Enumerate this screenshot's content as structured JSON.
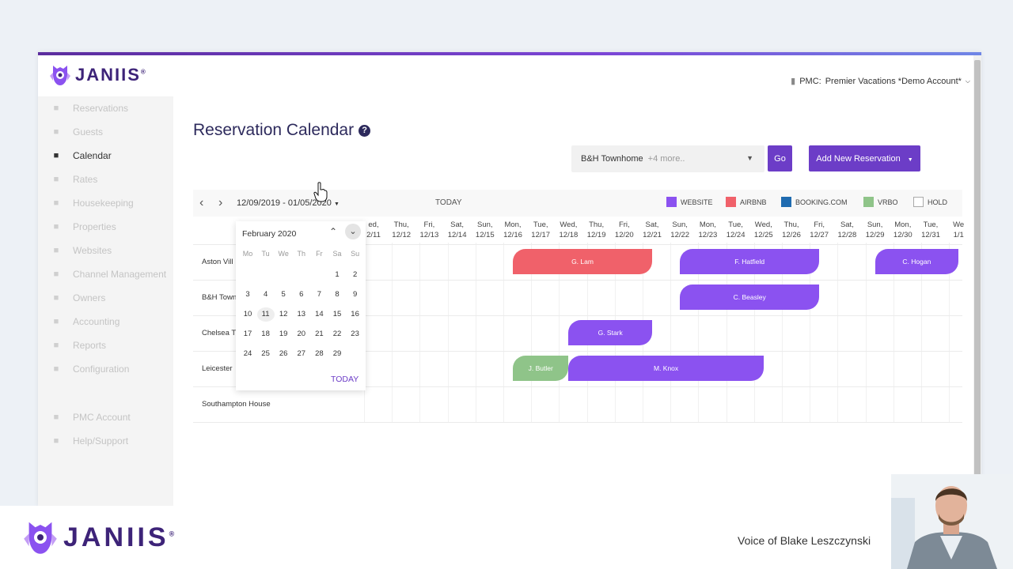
{
  "app": {
    "logo": "JANIIS",
    "trademark": "®",
    "pmc_label": "PMC:",
    "pmc_value": "Premier Vacations *Demo Account*"
  },
  "sidebar": {
    "items": [
      {
        "label": "Reservations",
        "icon": "id-card-icon",
        "active": false
      },
      {
        "label": "Guests",
        "icon": "guest-card-icon",
        "active": false
      },
      {
        "label": "Calendar",
        "icon": "calendar-icon",
        "active": true
      },
      {
        "label": "Rates",
        "icon": "dollar-icon",
        "active": false
      },
      {
        "label": "Housekeeping",
        "icon": "broom-icon",
        "active": false
      },
      {
        "label": "Properties",
        "icon": "home-icon",
        "active": false
      },
      {
        "label": "Websites",
        "icon": "monitor-icon",
        "active": false
      },
      {
        "label": "Channel Management",
        "icon": "chart-line-icon",
        "active": false
      },
      {
        "label": "Owners",
        "icon": "eye-icon",
        "active": false
      },
      {
        "label": "Accounting",
        "icon": "calculator-icon",
        "active": false
      },
      {
        "label": "Reports",
        "icon": "bar-chart-icon",
        "active": false
      },
      {
        "label": "Configuration",
        "icon": "gear-icon",
        "active": false
      }
    ],
    "bottom": [
      {
        "label": "PMC Account",
        "icon": "building-icon"
      },
      {
        "label": "Help/Support",
        "icon": "question-icon"
      }
    ]
  },
  "main": {
    "title": "Reservation Calendar",
    "help": "?",
    "property_select": "B&H Townhome",
    "property_more": "+4 more..",
    "go_label": "Go",
    "add_label": "Add New Reservation"
  },
  "calendar": {
    "date_range": "12/09/2019 - 01/05/2020",
    "today_label": "TODAY",
    "legend": [
      {
        "label": "WEBSITE",
        "color": "#8b52f0",
        "filled": true
      },
      {
        "label": "AIRBNB",
        "color": "#f0616a",
        "filled": true
      },
      {
        "label": "BOOKING.COM",
        "color": "#1f6bb0",
        "filled": true
      },
      {
        "label": "VRBO",
        "color": "#8fc489",
        "filled": true
      },
      {
        "label": "HOLD",
        "color": "#ffffff",
        "filled": false
      }
    ],
    "days": [
      {
        "d": "ed,",
        "n": "2/11"
      },
      {
        "d": "Thu,",
        "n": "12/12"
      },
      {
        "d": "Fri,",
        "n": "12/13"
      },
      {
        "d": "Sat,",
        "n": "12/14"
      },
      {
        "d": "Sun,",
        "n": "12/15"
      },
      {
        "d": "Mon,",
        "n": "12/16"
      },
      {
        "d": "Tue,",
        "n": "12/17"
      },
      {
        "d": "Wed,",
        "n": "12/18"
      },
      {
        "d": "Thu,",
        "n": "12/19"
      },
      {
        "d": "Fri,",
        "n": "12/20"
      },
      {
        "d": "Sat,",
        "n": "12/21"
      },
      {
        "d": "Sun,",
        "n": "12/22"
      },
      {
        "d": "Mon,",
        "n": "12/23"
      },
      {
        "d": "Tue,",
        "n": "12/24"
      },
      {
        "d": "Wed,",
        "n": "12/25"
      },
      {
        "d": "Thu,",
        "n": "12/26"
      },
      {
        "d": "Fri,",
        "n": "12/27"
      },
      {
        "d": "Sat,",
        "n": "12/28"
      },
      {
        "d": "Sun,",
        "n": "12/29"
      },
      {
        "d": "Mon,",
        "n": "12/30"
      },
      {
        "d": "Tue,",
        "n": "12/31"
      },
      {
        "d": "We",
        "n": "1/1"
      }
    ],
    "rows": [
      "Aston Vill",
      "B&H Town",
      "Chelsea T",
      "Leicester",
      "Southampton House"
    ],
    "reservations": [
      {
        "guest": "G. Lam",
        "row": 0,
        "start": "12/16",
        "end": "12/21",
        "color": "#f0616a"
      },
      {
        "guest": "F. Hatfield",
        "row": 0,
        "start": "12/22",
        "end": "12/27",
        "color": "#8b52f0"
      },
      {
        "guest": "C. Hogan",
        "row": 0,
        "start": "12/29",
        "end": "1/1",
        "color": "#8b52f0"
      },
      {
        "guest": "C. Beasley",
        "row": 1,
        "start": "12/22",
        "end": "12/27",
        "color": "#8b52f0"
      },
      {
        "guest": "G. Stark",
        "row": 2,
        "start": "12/18",
        "end": "12/21",
        "color": "#8b52f0"
      },
      {
        "guest": "J. Butler",
        "row": 3,
        "start": "12/16",
        "end": "12/18",
        "color": "#8fc489"
      },
      {
        "guest": "M. Knox",
        "row": 3,
        "start": "12/18",
        "end": "12/25",
        "color": "#8b52f0"
      }
    ]
  },
  "datepicker": {
    "month": "February 2020",
    "weekdays": [
      "Mo",
      "Tu",
      "We",
      "Th",
      "Fr",
      "Sa",
      "Su"
    ],
    "weeks": [
      [
        "",
        "",
        "",
        "",
        "",
        "1",
        "2"
      ],
      [
        "3",
        "4",
        "5",
        "6",
        "7",
        "8",
        "9"
      ],
      [
        "10",
        "11",
        "12",
        "13",
        "14",
        "15",
        "16"
      ],
      [
        "17",
        "18",
        "19",
        "20",
        "21",
        "22",
        "23"
      ],
      [
        "24",
        "25",
        "26",
        "27",
        "28",
        "29",
        ""
      ]
    ],
    "selected": "11",
    "today_label": "TODAY"
  },
  "footer": {
    "logo": "JANIIS",
    "trademark": "®",
    "voice": "Voice of Blake Leszczynski"
  }
}
